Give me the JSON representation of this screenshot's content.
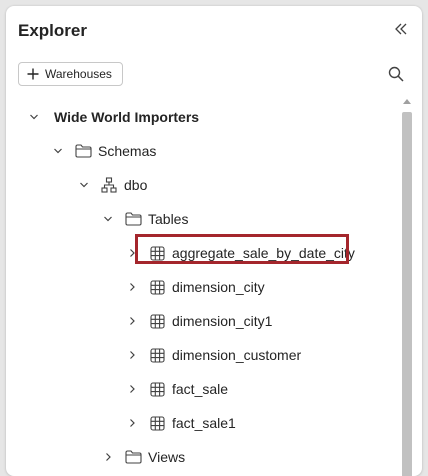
{
  "header": {
    "title": "Explorer"
  },
  "toolbar": {
    "add_label": "Warehouses"
  },
  "tree": {
    "root": "Wide World Importers",
    "schemas": "Schemas",
    "dbo": "dbo",
    "tables": "Tables",
    "items": [
      "aggregate_sale_by_date_city",
      "dimension_city",
      "dimension_city1",
      "dimension_customer",
      "fact_sale",
      "fact_sale1"
    ],
    "views": "Views"
  },
  "colors": {
    "highlight": "#a4262c",
    "scroll_thumb": "#c1c1c1"
  }
}
